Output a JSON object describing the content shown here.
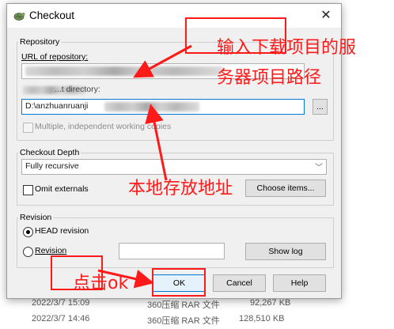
{
  "background_rows": [
    {
      "date": "2022/3/7 15:09",
      "type": "360压缩 RAR 文件",
      "size": "92,267 KB"
    },
    {
      "date": "2022/3/7 14:46",
      "type": "360压缩 RAR 文件",
      "size": "128,510 KB"
    }
  ],
  "dialog": {
    "title": "Checkout",
    "icon": "tortoise-checkout-icon",
    "close_glyph": "✕",
    "repository": {
      "group_label": "Repository",
      "url_label": "URL of repository:",
      "dir_label_visible": "...t directory:",
      "dir_value": "D:\\anzhuanruanji",
      "browse_label": "...",
      "multiple_label": "Multiple, independent working copies"
    },
    "depth": {
      "group_label": "Checkout Depth",
      "selected": "Fully recursive",
      "omit_label": "Omit externals",
      "choose_label": "Choose items..."
    },
    "revision": {
      "group_label": "Revision",
      "head_label": "HEAD revision",
      "revision_label": "Revision",
      "showlog_label": "Show log"
    },
    "buttons": {
      "ok": "OK",
      "cancel": "Cancel",
      "help": "Help"
    }
  },
  "annotations": {
    "url_note_line1": "输入下载项目的服",
    "url_note_line2": "务器项目路径",
    "dir_note": "本地存放地址",
    "ok_note": "点击ok",
    "color": "#ff1a1a"
  }
}
